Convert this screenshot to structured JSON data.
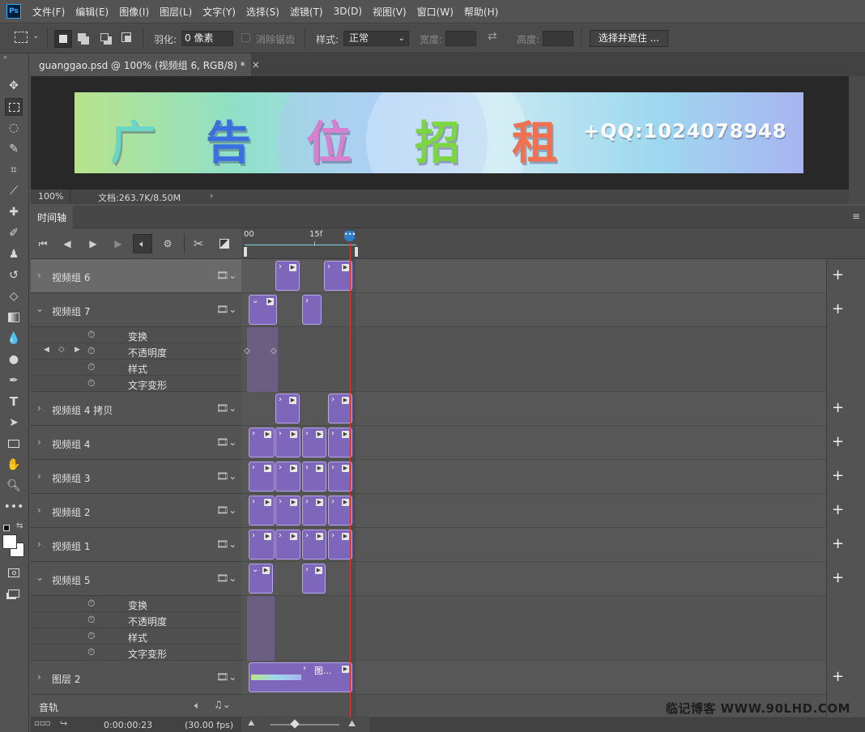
{
  "menubar": {
    "logo": "Ps",
    "items": [
      "文件(F)",
      "编辑(E)",
      "图像(I)",
      "图层(L)",
      "文字(Y)",
      "选择(S)",
      "滤镜(T)",
      "3D(D)",
      "视图(V)",
      "窗口(W)",
      "帮助(H)"
    ]
  },
  "options": {
    "feather_label": "羽化:",
    "feather_value": "0 像素",
    "antialias_label": "消除锯齿",
    "style_label": "样式:",
    "style_value": "正常",
    "width_label": "宽度:",
    "height_label": "高度:",
    "select_mask_button": "选择并遮住 ..."
  },
  "document": {
    "tab_title": "guanggao.psd @ 100% (视频组 6, RGB/8) *",
    "close_glyph": "×",
    "zoom": "100%",
    "doc_info": "文档:263.7K/8.50M"
  },
  "banner": {
    "chars": [
      "广",
      "告",
      "位",
      "招",
      "租"
    ],
    "qq": "+QQ:1024078948"
  },
  "timeline": {
    "tab_label": "时间轴",
    "ruler_start": "00",
    "ruler_mid": "15f",
    "layers": [
      {
        "name": "视频组 6",
        "expanded": false,
        "selected": true
      },
      {
        "name": "视频组 7",
        "expanded": true,
        "props": [
          "变换",
          "不透明度",
          "样式",
          "文字变形"
        ]
      },
      {
        "name": "视频组 4 拷贝",
        "expanded": false
      },
      {
        "name": "视频组 4",
        "expanded": false
      },
      {
        "name": "视频组 3",
        "expanded": false
      },
      {
        "name": "视频组 2",
        "expanded": false
      },
      {
        "name": "视频组 1",
        "expanded": false
      },
      {
        "name": "视频组 5",
        "expanded": true,
        "props": [
          "变换",
          "不透明度",
          "样式",
          "文字变形"
        ]
      },
      {
        "name": "图层 2",
        "expanded": false,
        "clip_label": "图..."
      }
    ],
    "audio_track": "音轨",
    "timecode": "0:00:00:23",
    "fps": "(30.00 fps)"
  },
  "watermark": "临记博客 WWW.90LHD.COM",
  "colors": {
    "clip_fill": "#7e66bb",
    "clip_border": "#b9a5ec",
    "playhead": "#d23c3c",
    "playhead_marker": "#2d7dd2"
  }
}
